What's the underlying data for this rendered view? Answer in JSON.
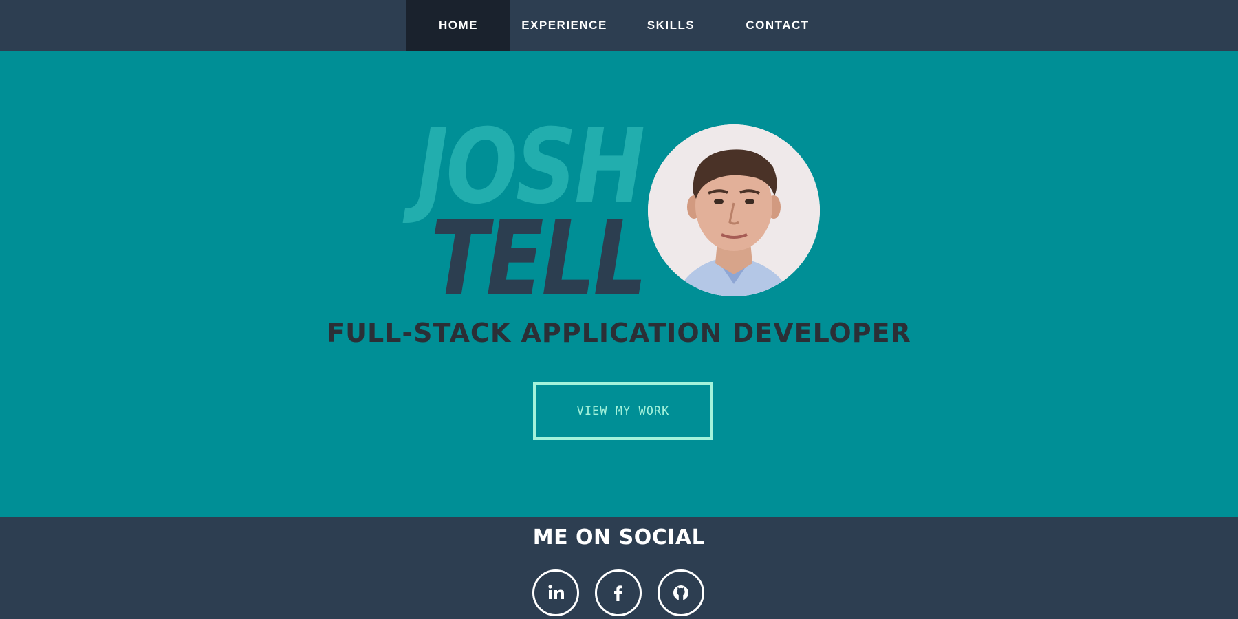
{
  "nav": {
    "items": [
      {
        "label": "HOME",
        "active": true
      },
      {
        "label": "EXPERIENCE",
        "active": false
      },
      {
        "label": "SKILLS",
        "active": false
      },
      {
        "label": "CONTACT",
        "active": false
      }
    ]
  },
  "hero": {
    "first_name": "JOSH",
    "last_name": "TELL",
    "subtitle": "FULL-STACK APPLICATION DEVELOPER",
    "cta_label": "VIEW MY WORK",
    "avatar_icon": "profile-photo"
  },
  "social": {
    "title": "ME ON SOCIAL",
    "links": [
      {
        "icon": "linkedin-icon"
      },
      {
        "icon": "facebook-icon"
      },
      {
        "icon": "github-icon"
      }
    ]
  },
  "colors": {
    "nav_bg": "#2d3e51",
    "nav_active_bg": "#1a222d",
    "hero_bg": "#008f96",
    "first_name": "#22aeae",
    "last_name": "#2c3e50",
    "cta_accent": "#a3f2db",
    "subtitle": "#2b2f36"
  }
}
